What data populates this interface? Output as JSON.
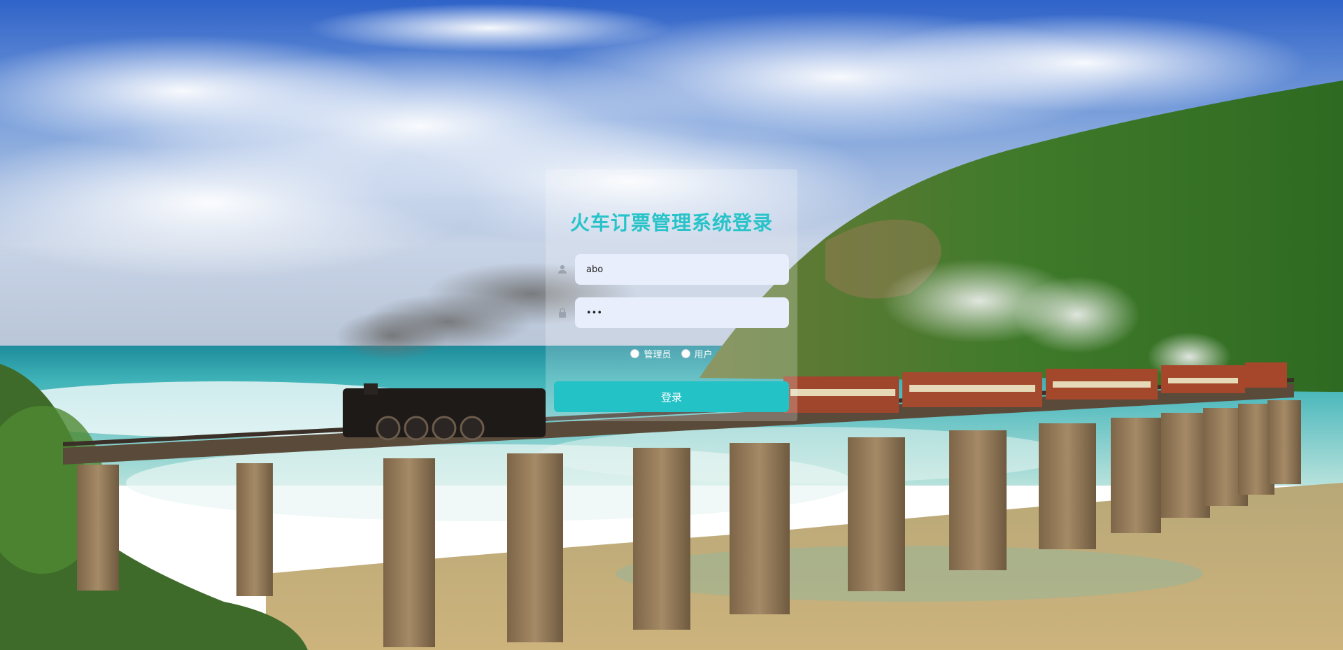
{
  "login": {
    "title": "火车订票管理系统登录",
    "username_value": "abo",
    "password_value": "•••",
    "roles": [
      {
        "label": "管理员",
        "selected": false
      },
      {
        "label": "用户",
        "selected": false
      }
    ],
    "submit_label": "登录"
  },
  "icons": {
    "username": "user-icon",
    "password": "lock-icon"
  },
  "colors": {
    "accent": "#22c2c7",
    "title": "#27c3c8",
    "input_bg": "#e8eefb"
  },
  "background": {
    "subject": "steam-train-on-coastal-bridge-photo"
  }
}
